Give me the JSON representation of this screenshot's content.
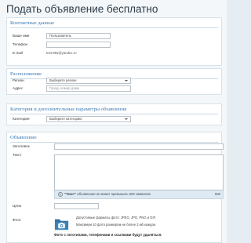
{
  "page": {
    "title": "Подать объявление бесплатно"
  },
  "contacts": {
    "header": "Контактные данные",
    "name_label": "Ваше имя",
    "name_value": "Пользователь",
    "phone_label": "Телефон",
    "phone_value": "",
    "email_label": "E-mail",
    "email_value": "test-99s@yandex.ru"
  },
  "location": {
    "header": "Расположение",
    "region_label": "Регион",
    "region_value": "Выберите регион",
    "address_label": "Адрес",
    "address_placeholder": "Город, номер дома"
  },
  "category": {
    "header": "Категория и дополнительные параметры объявления",
    "category_label": "Категория",
    "category_value": "Выберите категорию"
  },
  "ad": {
    "header": "Объявление",
    "title_label": "Заголовок",
    "text_label": "Текст",
    "text_note_bold": "\"Текст\"",
    "text_note_rest": " объявления не может превышать 500 символов",
    "text_counter": "500",
    "price_label": "Цена",
    "photo_label": "Фото",
    "photo_formats": "Допустимые форматы фото: JPEG, JPG, PNG и GIF.",
    "photo_limit": "Максимум 10 фото размером не более 2 мб каждое.",
    "photo_warning": "Фото с логотипами, телефонами и ссылками будут удаляться."
  },
  "colors": {
    "section_header": "#3a7bb5",
    "counter_bar": "#dfe9f1",
    "photo_icon": "#2f6f9f"
  },
  "icons": {
    "info": "info-icon",
    "photo": "camera-folder-icon",
    "dropdown": "chevron-down-icon"
  }
}
